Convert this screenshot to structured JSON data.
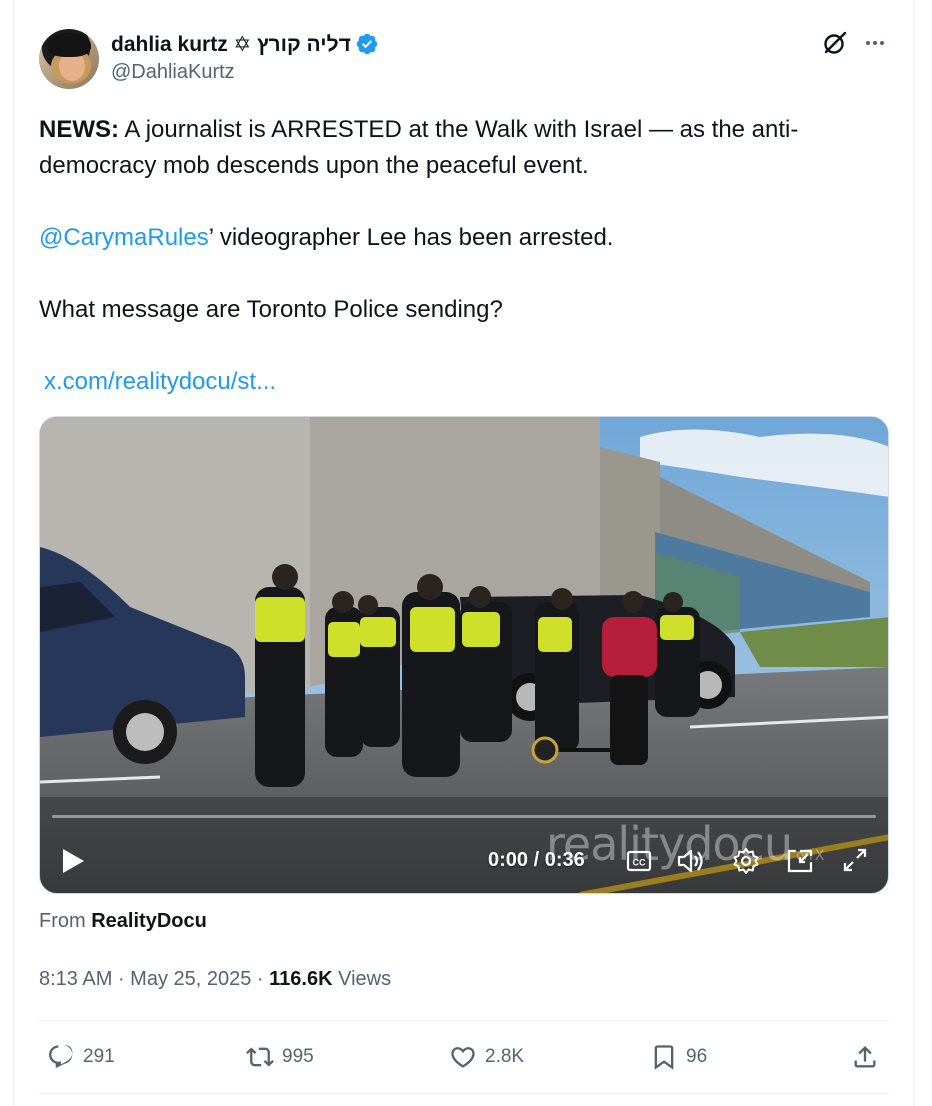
{
  "author": {
    "display_name": "dahlia kurtz ✡ דליה קורץ",
    "handle": "@DahliaKurtz"
  },
  "tweet": {
    "news_label": "NEWS:",
    "line1_rest": " A journalist is ARRESTED at the Walk with Israel — as the anti-democracy mob descends upon the peaceful event.",
    "mention": "@CarymaRules",
    "mention_rest": "’ videographer Lee has been arrested.",
    "question": "What message are Toronto Police sending?",
    "link": "x.com/realitydocu/st..."
  },
  "video": {
    "time": "0:00 / 0:36",
    "watermark": "realitydocu",
    "watermark_suffix": "on X",
    "progress": 0
  },
  "source": {
    "from_label": "From",
    "from_name": "RealityDocu"
  },
  "meta": {
    "time": "8:13 AM",
    "date": "May 25, 2025",
    "views_count": "116.6K",
    "views_label": "Views"
  },
  "actions": {
    "replies": "291",
    "reposts": "995",
    "likes": "2.8K",
    "bookmarks": "96"
  },
  "colors": {
    "accent": "#1d9bf0",
    "text": "#0f1419",
    "muted": "#536471",
    "verified": "#1d9bf0"
  },
  "icons": [
    "verified-badge-icon",
    "grok-icon",
    "more-icon",
    "play-icon",
    "cc-icon",
    "volume-icon",
    "settings-icon",
    "pip-icon",
    "fullscreen-icon",
    "reply-icon",
    "retweet-icon",
    "heart-icon",
    "bookmark-icon",
    "share-icon"
  ]
}
